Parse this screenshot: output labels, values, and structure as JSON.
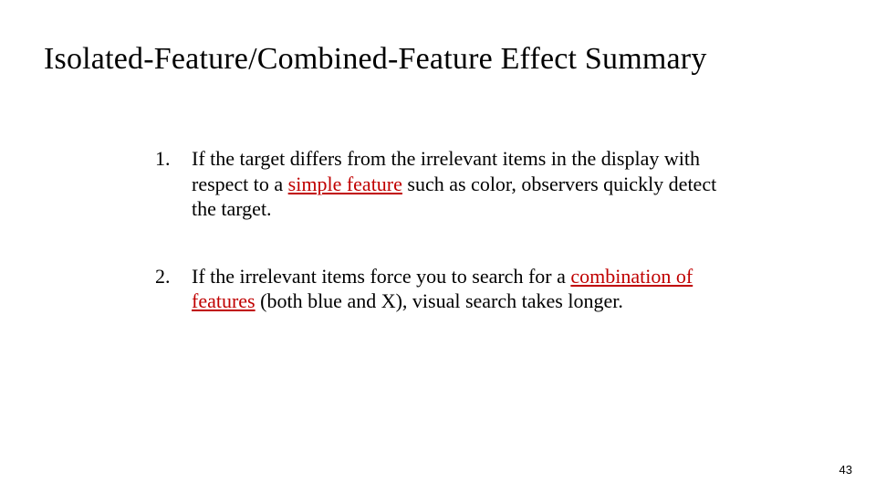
{
  "slide": {
    "title": "Isolated-Feature/Combined-Feature Effect Summary",
    "points": [
      {
        "pre": "If the target differs from the irrelevant items in the display with respect to a ",
        "emph": "simple feature",
        "post": " such as color, observers quickly detect the target."
      },
      {
        "pre": "If the irrelevant items force you to search for a ",
        "emph": "combination of features",
        "post": " (both blue and X), visual search takes longer."
      }
    ],
    "page_number": "43"
  }
}
